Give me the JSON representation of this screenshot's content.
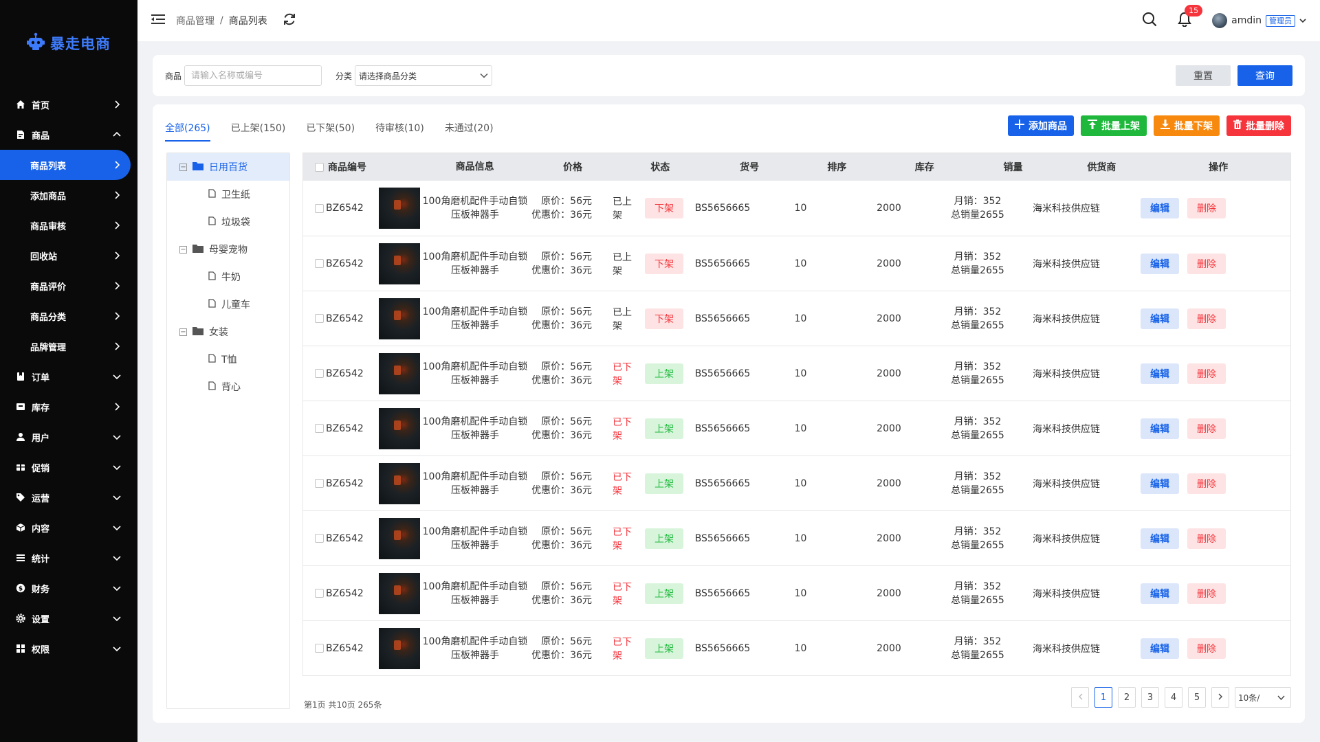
{
  "app": {
    "logo_text": "暴走电商"
  },
  "sidebar": {
    "items": [
      {
        "label": "首页",
        "icon": "home-icon",
        "arrow": "right"
      },
      {
        "label": "商品",
        "icon": "product-icon",
        "arrow": "up"
      },
      {
        "label": "商品列表",
        "sub": true,
        "active": true,
        "arrow": "right"
      },
      {
        "label": "添加商品",
        "sub": true,
        "arrow": "right"
      },
      {
        "label": "商品审核",
        "sub": true,
        "arrow": "right"
      },
      {
        "label": "回收站",
        "sub": true,
        "arrow": "right"
      },
      {
        "label": "商品评价",
        "sub": true,
        "arrow": "right"
      },
      {
        "label": "商品分类",
        "sub": true,
        "arrow": "right"
      },
      {
        "label": "品牌管理",
        "sub": true,
        "arrow": "right"
      },
      {
        "label": "订单",
        "icon": "order-icon",
        "arrow": "down"
      },
      {
        "label": "库存",
        "icon": "stock-icon",
        "arrow": "right"
      },
      {
        "label": "用户",
        "icon": "user-icon",
        "arrow": "down"
      },
      {
        "label": "促销",
        "icon": "promotion-icon",
        "arrow": "down"
      },
      {
        "label": "运营",
        "icon": "tag-icon",
        "arrow": "down"
      },
      {
        "label": "内容",
        "icon": "content-icon",
        "arrow": "down"
      },
      {
        "label": "统计",
        "icon": "stats-icon",
        "arrow": "down"
      },
      {
        "label": "财务",
        "icon": "finance-icon",
        "arrow": "down"
      },
      {
        "label": "设置",
        "icon": "settings-icon",
        "arrow": "down"
      },
      {
        "label": "权限",
        "icon": "permission-icon",
        "arrow": "down"
      }
    ]
  },
  "header": {
    "breadcrumb": [
      "商品管理",
      "商品列表"
    ],
    "separator": "/",
    "notif_count": "15",
    "username": "amdin",
    "role": "管理员"
  },
  "filter": {
    "product_label": "商品",
    "product_placeholder": "请输入名称或编号",
    "category_label": "分类",
    "category_placeholder": "请选择商品分类",
    "reset_label": "重置",
    "query_label": "查询"
  },
  "tabs": [
    {
      "label": "全部(265)",
      "active": true
    },
    {
      "label": "已上架(150)"
    },
    {
      "label": "已下架(50)"
    },
    {
      "label": "待审核(10)"
    },
    {
      "label": "未通过(20)"
    }
  ],
  "actions": {
    "add": "添加商品",
    "batch_on": "批量上架",
    "batch_off": "批量下架",
    "batch_delete": "批量删除"
  },
  "colors": {
    "primary": "#1762e8",
    "green": "#1fb83c",
    "orange": "#f7890e",
    "red": "#f5343c"
  },
  "tree": [
    {
      "label": "日用百货",
      "type": "folder",
      "selected": true
    },
    {
      "label": "卫生纸",
      "type": "leaf"
    },
    {
      "label": "垃圾袋",
      "type": "leaf"
    },
    {
      "label": "母婴宠物",
      "type": "folder"
    },
    {
      "label": "牛奶",
      "type": "leaf"
    },
    {
      "label": "儿童车",
      "type": "leaf"
    },
    {
      "label": "女装",
      "type": "folder"
    },
    {
      "label": "T恤",
      "type": "leaf"
    },
    {
      "label": "背心",
      "type": "leaf"
    }
  ],
  "table": {
    "columns": [
      "商品编号",
      "商品信息",
      "价格",
      "状态",
      "货号",
      "排序",
      "库存",
      "销量",
      "供货商",
      "操作"
    ],
    "rows": [
      {
        "code": "BZ6542",
        "name": "100角磨机配件手动自锁压板神器手",
        "orig": "原价：56元",
        "disc": "优惠价：36元",
        "status": "已上架",
        "status_type": "on",
        "toggle": "下架",
        "sku": "BS5656665",
        "sort": "10",
        "stock": "2000",
        "monthly": "月销：352",
        "total": "总销量2655",
        "supplier": "海米科技供应链",
        "edit": "编辑",
        "delete": "删除"
      },
      {
        "code": "BZ6542",
        "name": "100角磨机配件手动自锁压板神器手",
        "orig": "原价：56元",
        "disc": "优惠价：36元",
        "status": "已上架",
        "status_type": "on",
        "toggle": "下架",
        "sku": "BS5656665",
        "sort": "10",
        "stock": "2000",
        "monthly": "月销：352",
        "total": "总销量2655",
        "supplier": "海米科技供应链",
        "edit": "编辑",
        "delete": "删除"
      },
      {
        "code": "BZ6542",
        "name": "100角磨机配件手动自锁压板神器手",
        "orig": "原价：56元",
        "disc": "优惠价：36元",
        "status": "已上架",
        "status_type": "on",
        "toggle": "下架",
        "sku": "BS5656665",
        "sort": "10",
        "stock": "2000",
        "monthly": "月销：352",
        "total": "总销量2655",
        "supplier": "海米科技供应链",
        "edit": "编辑",
        "delete": "删除"
      },
      {
        "code": "BZ6542",
        "name": "100角磨机配件手动自锁压板神器手",
        "orig": "原价：56元",
        "disc": "优惠价：36元",
        "status": "已下架",
        "status_type": "off",
        "toggle": "上架",
        "sku": "BS5656665",
        "sort": "10",
        "stock": "2000",
        "monthly": "月销：352",
        "total": "总销量2655",
        "supplier": "海米科技供应链",
        "edit": "编辑",
        "delete": "删除"
      },
      {
        "code": "BZ6542",
        "name": "100角磨机配件手动自锁压板神器手",
        "orig": "原价：56元",
        "disc": "优惠价：36元",
        "status": "已下架",
        "status_type": "off",
        "toggle": "上架",
        "sku": "BS5656665",
        "sort": "10",
        "stock": "2000",
        "monthly": "月销：352",
        "total": "总销量2655",
        "supplier": "海米科技供应链",
        "edit": "编辑",
        "delete": "删除"
      },
      {
        "code": "BZ6542",
        "name": "100角磨机配件手动自锁压板神器手",
        "orig": "原价：56元",
        "disc": "优惠价：36元",
        "status": "已下架",
        "status_type": "off",
        "toggle": "上架",
        "sku": "BS5656665",
        "sort": "10",
        "stock": "2000",
        "monthly": "月销：352",
        "total": "总销量2655",
        "supplier": "海米科技供应链",
        "edit": "编辑",
        "delete": "删除"
      },
      {
        "code": "BZ6542",
        "name": "100角磨机配件手动自锁压板神器手",
        "orig": "原价：56元",
        "disc": "优惠价：36元",
        "status": "已下架",
        "status_type": "off",
        "toggle": "上架",
        "sku": "BS5656665",
        "sort": "10",
        "stock": "2000",
        "monthly": "月销：352",
        "total": "总销量2655",
        "supplier": "海米科技供应链",
        "edit": "编辑",
        "delete": "删除"
      },
      {
        "code": "BZ6542",
        "name": "100角磨机配件手动自锁压板神器手",
        "orig": "原价：56元",
        "disc": "优惠价：36元",
        "status": "已下架",
        "status_type": "off",
        "toggle": "上架",
        "sku": "BS5656665",
        "sort": "10",
        "stock": "2000",
        "monthly": "月销：352",
        "total": "总销量2655",
        "supplier": "海米科技供应链",
        "edit": "编辑",
        "delete": "删除"
      },
      {
        "code": "BZ6542",
        "name": "100角磨机配件手动自锁压板神器手",
        "orig": "原价：56元",
        "disc": "优惠价：36元",
        "status": "已下架",
        "status_type": "off",
        "toggle": "上架",
        "sku": "BS5656665",
        "sort": "10",
        "stock": "2000",
        "monthly": "月销：352",
        "total": "总销量2655",
        "supplier": "海米科技供应链",
        "edit": "编辑",
        "delete": "删除"
      }
    ]
  },
  "pagination": {
    "info": "第1页 共10页 265条",
    "pages": [
      "1",
      "2",
      "3",
      "4",
      "5"
    ],
    "current": "1",
    "page_size": "10条/"
  }
}
